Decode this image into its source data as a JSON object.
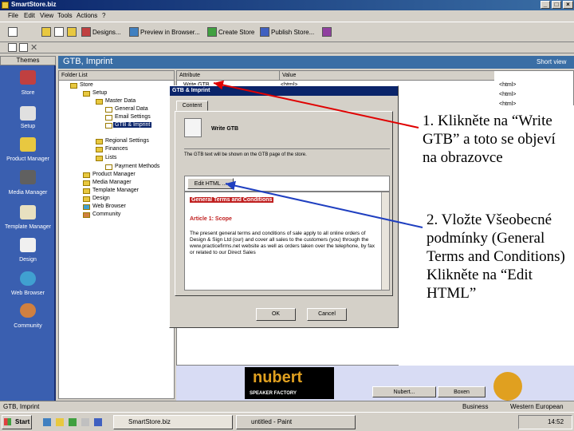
{
  "window": {
    "title": "SmartStore.biz"
  },
  "menu": [
    "File",
    "Edit",
    "View",
    "Tools",
    "Actions",
    "?"
  ],
  "toolbar": {
    "designs": "Designs...",
    "preview": "Preview in Browser...",
    "create_store": "Create Store",
    "publish_store": "Publish Store..."
  },
  "themes": "Themes",
  "nav": [
    "Store",
    "Setup",
    "Product Manager",
    "Media Manager",
    "Template Manager",
    "Design",
    "Web Browser",
    "Community"
  ],
  "header": {
    "title": "GTB, Imprint",
    "short": "Short view"
  },
  "folder_list": {
    "title": "Folder List",
    "items": [
      "Store",
      "Setup",
      "Master Data",
      "General Data",
      "Email Settings",
      "GTB & Imprint",
      "Regional Settings",
      "Finances",
      "Lists",
      "Payment Methods",
      "Product Manager",
      "Media Manager",
      "Template Manager",
      "Design",
      "Web Browser",
      "Community"
    ]
  },
  "right_panel": {
    "headers": [
      "Attribute",
      "Value"
    ],
    "rows": [
      [
        "Write GTB",
        "<html>"
      ],
      [
        "",
        "<html>"
      ],
      [
        "",
        "<html>"
      ]
    ]
  },
  "dialog": {
    "title": "GTB & Imprint",
    "tab": "Content",
    "heading": "Write GTB",
    "description": "The GTB text will be shown on the GTB page of the store.",
    "edit_button": "Edit HTML ...",
    "editor": {
      "heading": "General Terms and Conditions",
      "article": "Article 1: Scope",
      "body": "The present general terms and conditions of sale apply to all online orders of Design & Sign Ltd (our) and cover all sales to the customers (you) through the www.practicefirms.net website as well as orders taken over the telephone, by fax or related to our Direct Sales"
    },
    "ok": "OK",
    "cancel": "Cancel"
  },
  "annotation": {
    "step1": "1. Klikněte na “Write GTB” a toto se objeví na obrazovce",
    "step2": "2. Vložte Všeobecné podmínky (General Terms and Conditions) Klikněte na “Edit HTML”"
  },
  "banner": {
    "brand": "nubert",
    "tagline": "SPEAKER FACTORY",
    "tab1": "Nubert...",
    "tab2": "Boxen"
  },
  "status": {
    "left": "GTB, Imprint",
    "right_1": "Business",
    "right_2": "Western European"
  },
  "taskbar": {
    "start": "Start",
    "task1": "SmartStore.biz",
    "task2": "untitled - Paint",
    "clock": "14:52"
  },
  "colors": {
    "arrow1": "#e00000",
    "arrow2": "#1f3fc0",
    "nav_bg": "#3a5fb0",
    "title_bg": "#0a246a"
  }
}
